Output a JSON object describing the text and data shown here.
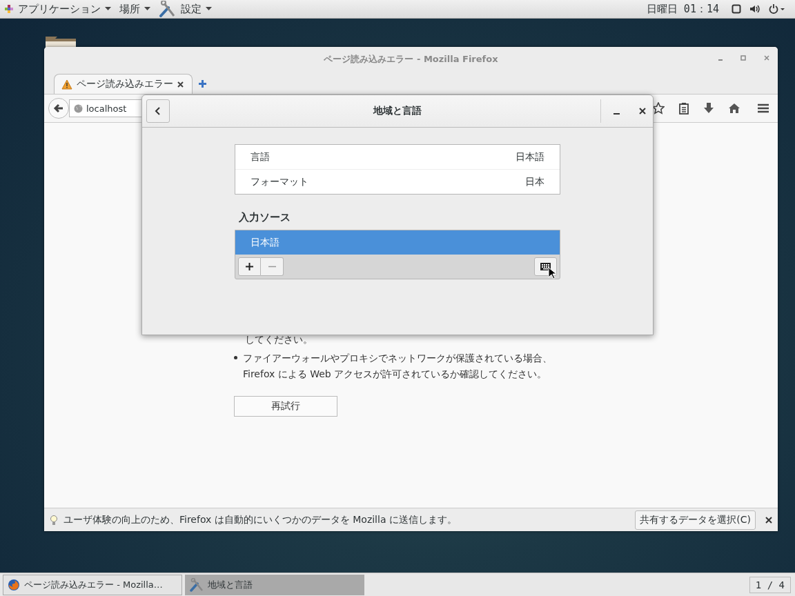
{
  "top_bar": {
    "menus": [
      {
        "label": "アプリケーション",
        "kind": "apps"
      },
      {
        "label": "場所",
        "kind": "places"
      },
      {
        "label": "設定",
        "kind": "settings"
      }
    ],
    "clock": "日曜日 01：14"
  },
  "firefox": {
    "title": "ページ読み込みエラー - Mozilla Firefox",
    "tabs": [
      {
        "label": "ページ読み込みエラー",
        "selected": true
      }
    ],
    "url": "localhost",
    "page": {
      "partial_line": "してください。",
      "bullets": [
        {
          "lines": [
            "ファイアーウォールやプロキシでネットワークが保護されている場合、",
            "Firefox による Web アクセスが許可されているか確認してください。"
          ]
        }
      ],
      "retry_button": "再試行"
    },
    "notification": {
      "text": "ユーザ体験の向上のため、Firefox は自動的にいくつかのデータを Mozilla に送信します。",
      "button": "共有するデータを選択(C)"
    }
  },
  "dialog": {
    "title": "地域と言語",
    "rows": [
      {
        "label": "言語",
        "value": "日本語"
      },
      {
        "label": "フォーマット",
        "value": "日本"
      }
    ],
    "section_title": "入力ソース",
    "input_sources": [
      {
        "label": "日本語",
        "selected": true
      }
    ]
  },
  "taskbar": {
    "items": [
      {
        "label": "ページ読み込みエラー - Mozilla…",
        "kind": "firefox",
        "selected": false
      },
      {
        "label": "地域と言語",
        "kind": "settings",
        "selected": true
      }
    ],
    "workspace": "1 / 4"
  }
}
